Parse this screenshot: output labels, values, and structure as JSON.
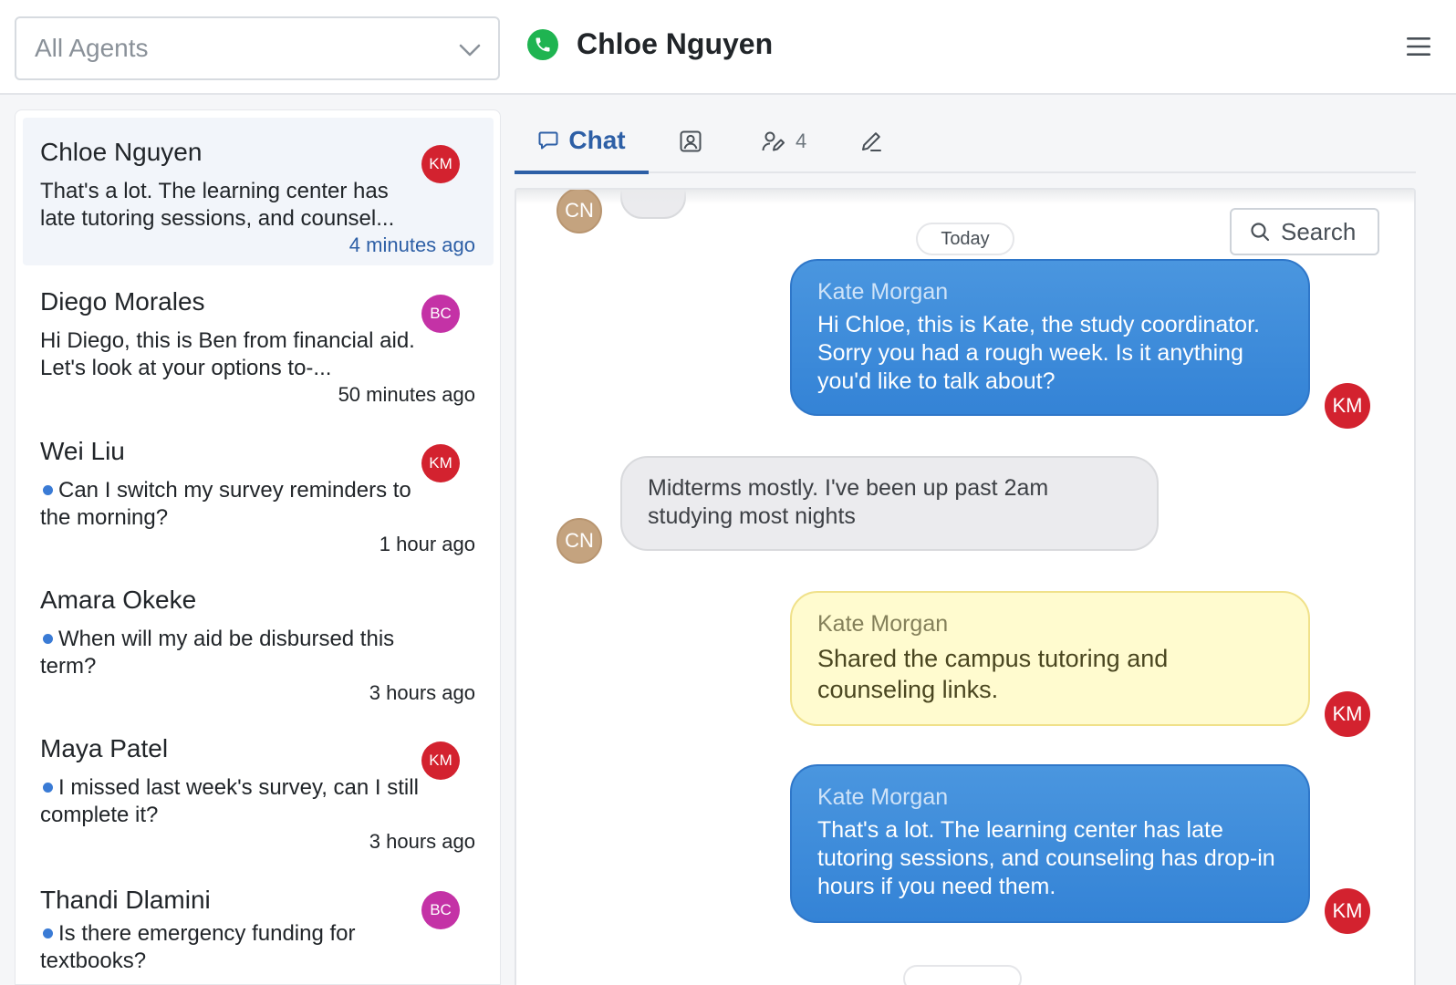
{
  "header": {
    "agent_filter": "All Agents",
    "contact_name": "Chloe Nguyen"
  },
  "conversations": [
    {
      "name": "Chloe Nguyen",
      "preview": "That's a lot. The learning center has late tutoring sessions, and counsel...",
      "time": "4 minutes ago",
      "badge": "KM",
      "unread": false,
      "active": true
    },
    {
      "name": "Diego Morales",
      "preview": "Hi Diego, this is Ben from financial aid. Let's look at your options to-...",
      "time": "50 minutes ago",
      "badge": "BC",
      "unread": false,
      "active": false
    },
    {
      "name": "Wei Liu",
      "preview": "Can I switch my survey reminders to the morning?",
      "time": "1 hour ago",
      "badge": "KM",
      "unread": true,
      "active": false
    },
    {
      "name": "Amara Okeke",
      "preview": "When will my aid be disbursed this term?",
      "time": "3 hours ago",
      "badge": "",
      "unread": true,
      "active": false
    },
    {
      "name": "Maya Patel",
      "preview": "I missed last week's survey, can I still complete it?",
      "time": "3 hours ago",
      "badge": "KM",
      "unread": true,
      "active": false
    },
    {
      "name": "Thandi Dlamini",
      "preview": "Is there emergency funding for textbooks?",
      "time": "",
      "badge": "BC",
      "unread": true,
      "active": false
    }
  ],
  "tabs": {
    "chat_label": "Chat",
    "assigned_count": "4"
  },
  "chat": {
    "date_divider": "Today",
    "search_label": "Search",
    "avatar_contact": "CN",
    "avatar_agent": "KM",
    "messages": [
      {
        "kind": "agent",
        "sender": "Kate Morgan",
        "text": "Hi Chloe, this is Kate, the study coordinator. Sorry you had a rough week. Is it anything you'd like to talk about?"
      },
      {
        "kind": "contact",
        "text": "Midterms mostly. I've been up past 2am studying most nights"
      },
      {
        "kind": "note",
        "sender": "Kate Morgan",
        "text": "Shared the campus tutoring and counseling links."
      },
      {
        "kind": "agent",
        "sender": "Kate Morgan",
        "text": "That's a lot. The learning center has late tutoring sessions, and counseling has drop-in hours if you need them."
      }
    ]
  },
  "colors": {
    "accent": "#2d5fa6",
    "agent_bubble": "#3f8edb",
    "note_bubble": "#fffbcf",
    "badge_km": "#d3222f",
    "badge_bc": "#c432a6",
    "phone": "#1fb451"
  },
  "icons": {
    "agent_dropdown": "chevron-down-icon",
    "phone": "phone-icon",
    "menu": "hamburger-menu-icon",
    "chat_tab": "chat-bubble-icon",
    "contact_tab": "contact-card-icon",
    "assign_tab": "user-edit-icon",
    "notes_tab": "pencil-icon",
    "search": "search-icon"
  }
}
